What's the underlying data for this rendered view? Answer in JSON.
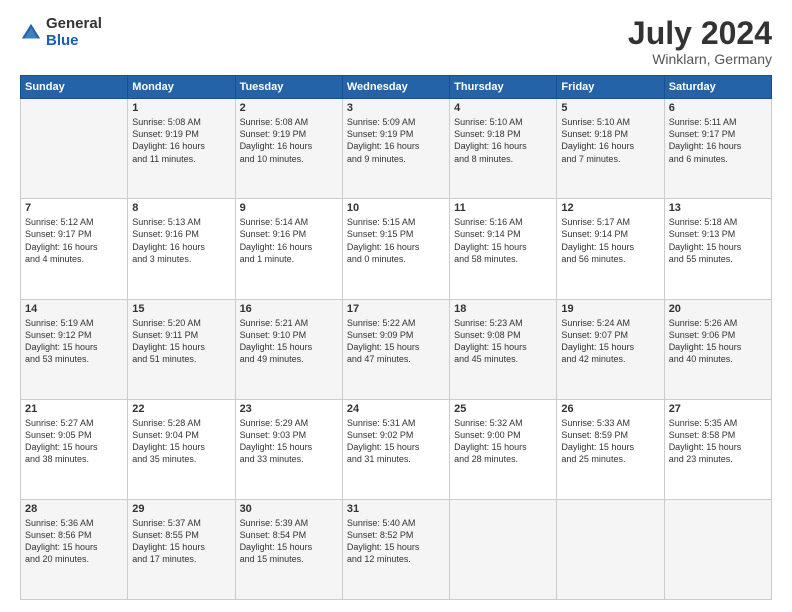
{
  "header": {
    "logo_general": "General",
    "logo_blue": "Blue",
    "title": "July 2024",
    "subtitle": "Winklarn, Germany"
  },
  "calendar": {
    "days_of_week": [
      "Sunday",
      "Monday",
      "Tuesday",
      "Wednesday",
      "Thursday",
      "Friday",
      "Saturday"
    ],
    "weeks": [
      [
        {
          "day": "",
          "info": ""
        },
        {
          "day": "1",
          "info": "Sunrise: 5:08 AM\nSunset: 9:19 PM\nDaylight: 16 hours\nand 11 minutes."
        },
        {
          "day": "2",
          "info": "Sunrise: 5:08 AM\nSunset: 9:19 PM\nDaylight: 16 hours\nand 10 minutes."
        },
        {
          "day": "3",
          "info": "Sunrise: 5:09 AM\nSunset: 9:19 PM\nDaylight: 16 hours\nand 9 minutes."
        },
        {
          "day": "4",
          "info": "Sunrise: 5:10 AM\nSunset: 9:18 PM\nDaylight: 16 hours\nand 8 minutes."
        },
        {
          "day": "5",
          "info": "Sunrise: 5:10 AM\nSunset: 9:18 PM\nDaylight: 16 hours\nand 7 minutes."
        },
        {
          "day": "6",
          "info": "Sunrise: 5:11 AM\nSunset: 9:17 PM\nDaylight: 16 hours\nand 6 minutes."
        }
      ],
      [
        {
          "day": "7",
          "info": "Sunrise: 5:12 AM\nSunset: 9:17 PM\nDaylight: 16 hours\nand 4 minutes."
        },
        {
          "day": "8",
          "info": "Sunrise: 5:13 AM\nSunset: 9:16 PM\nDaylight: 16 hours\nand 3 minutes."
        },
        {
          "day": "9",
          "info": "Sunrise: 5:14 AM\nSunset: 9:16 PM\nDaylight: 16 hours\nand 1 minute."
        },
        {
          "day": "10",
          "info": "Sunrise: 5:15 AM\nSunset: 9:15 PM\nDaylight: 16 hours\nand 0 minutes."
        },
        {
          "day": "11",
          "info": "Sunrise: 5:16 AM\nSunset: 9:14 PM\nDaylight: 15 hours\nand 58 minutes."
        },
        {
          "day": "12",
          "info": "Sunrise: 5:17 AM\nSunset: 9:14 PM\nDaylight: 15 hours\nand 56 minutes."
        },
        {
          "day": "13",
          "info": "Sunrise: 5:18 AM\nSunset: 9:13 PM\nDaylight: 15 hours\nand 55 minutes."
        }
      ],
      [
        {
          "day": "14",
          "info": "Sunrise: 5:19 AM\nSunset: 9:12 PM\nDaylight: 15 hours\nand 53 minutes."
        },
        {
          "day": "15",
          "info": "Sunrise: 5:20 AM\nSunset: 9:11 PM\nDaylight: 15 hours\nand 51 minutes."
        },
        {
          "day": "16",
          "info": "Sunrise: 5:21 AM\nSunset: 9:10 PM\nDaylight: 15 hours\nand 49 minutes."
        },
        {
          "day": "17",
          "info": "Sunrise: 5:22 AM\nSunset: 9:09 PM\nDaylight: 15 hours\nand 47 minutes."
        },
        {
          "day": "18",
          "info": "Sunrise: 5:23 AM\nSunset: 9:08 PM\nDaylight: 15 hours\nand 45 minutes."
        },
        {
          "day": "19",
          "info": "Sunrise: 5:24 AM\nSunset: 9:07 PM\nDaylight: 15 hours\nand 42 minutes."
        },
        {
          "day": "20",
          "info": "Sunrise: 5:26 AM\nSunset: 9:06 PM\nDaylight: 15 hours\nand 40 minutes."
        }
      ],
      [
        {
          "day": "21",
          "info": "Sunrise: 5:27 AM\nSunset: 9:05 PM\nDaylight: 15 hours\nand 38 minutes."
        },
        {
          "day": "22",
          "info": "Sunrise: 5:28 AM\nSunset: 9:04 PM\nDaylight: 15 hours\nand 35 minutes."
        },
        {
          "day": "23",
          "info": "Sunrise: 5:29 AM\nSunset: 9:03 PM\nDaylight: 15 hours\nand 33 minutes."
        },
        {
          "day": "24",
          "info": "Sunrise: 5:31 AM\nSunset: 9:02 PM\nDaylight: 15 hours\nand 31 minutes."
        },
        {
          "day": "25",
          "info": "Sunrise: 5:32 AM\nSunset: 9:00 PM\nDaylight: 15 hours\nand 28 minutes."
        },
        {
          "day": "26",
          "info": "Sunrise: 5:33 AM\nSunset: 8:59 PM\nDaylight: 15 hours\nand 25 minutes."
        },
        {
          "day": "27",
          "info": "Sunrise: 5:35 AM\nSunset: 8:58 PM\nDaylight: 15 hours\nand 23 minutes."
        }
      ],
      [
        {
          "day": "28",
          "info": "Sunrise: 5:36 AM\nSunset: 8:56 PM\nDaylight: 15 hours\nand 20 minutes."
        },
        {
          "day": "29",
          "info": "Sunrise: 5:37 AM\nSunset: 8:55 PM\nDaylight: 15 hours\nand 17 minutes."
        },
        {
          "day": "30",
          "info": "Sunrise: 5:39 AM\nSunset: 8:54 PM\nDaylight: 15 hours\nand 15 minutes."
        },
        {
          "day": "31",
          "info": "Sunrise: 5:40 AM\nSunset: 8:52 PM\nDaylight: 15 hours\nand 12 minutes."
        },
        {
          "day": "",
          "info": ""
        },
        {
          "day": "",
          "info": ""
        },
        {
          "day": "",
          "info": ""
        }
      ]
    ]
  }
}
